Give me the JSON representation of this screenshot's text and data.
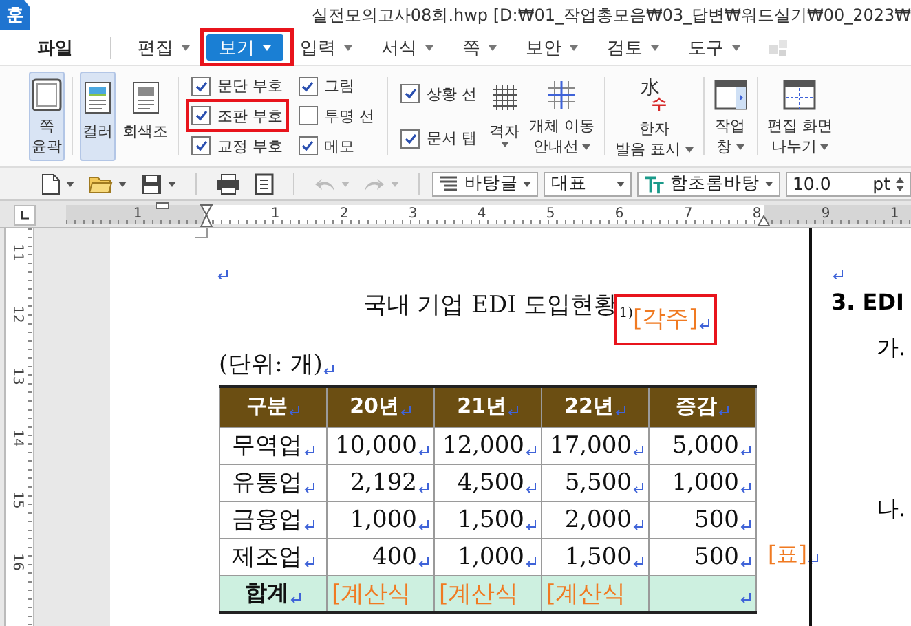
{
  "title_bar": {
    "logo": "훈",
    "title": "실전모의고사08회.hwp [D:₩01_작업총모음₩03_답변₩워드실기₩00_2023₩"
  },
  "menu": [
    {
      "label": "파일",
      "menu": false,
      "selected": false,
      "highlighted": false
    },
    {
      "label": "편집",
      "menu": true,
      "selected": false,
      "highlighted": false
    },
    {
      "label": "보기",
      "menu": true,
      "selected": true,
      "highlighted": true
    },
    {
      "label": "입력",
      "menu": true,
      "selected": false,
      "highlighted": false
    },
    {
      "label": "서식",
      "menu": true,
      "selected": false,
      "highlighted": false
    },
    {
      "label": "쪽",
      "menu": true,
      "selected": false,
      "highlighted": false
    },
    {
      "label": "보안",
      "menu": true,
      "selected": false,
      "highlighted": false
    },
    {
      "label": "검토",
      "menu": true,
      "selected": false,
      "highlighted": false
    },
    {
      "label": "도구",
      "menu": true,
      "selected": false,
      "highlighted": false
    }
  ],
  "ribbon": {
    "groups": [
      [
        {
          "kind": "outline",
          "lines": [
            "쪽",
            "윤곽"
          ],
          "selected": true,
          "menu": false
        }
      ],
      [
        {
          "kind": "color",
          "lines": [
            "컬러"
          ],
          "selected": true,
          "menu": false
        },
        {
          "kind": "gray",
          "lines": [
            "회색조"
          ],
          "selected": false,
          "menu": false
        }
      ],
      [
        {
          "kind": "checks",
          "items": [
            {
              "label": "문단 부호",
              "checked": true,
              "highlighted": false
            },
            {
              "label": "조판 부호",
              "checked": true,
              "highlighted": true
            },
            {
              "label": "교정 부호",
              "checked": true,
              "highlighted": false
            }
          ]
        },
        {
          "kind": "checks",
          "items": [
            {
              "label": "그림",
              "checked": true,
              "highlighted": false
            },
            {
              "label": "투명 선",
              "checked": false,
              "highlighted": false
            },
            {
              "label": "메모",
              "checked": true,
              "highlighted": false
            }
          ]
        }
      ],
      [
        {
          "kind": "checks",
          "items": [
            {
              "label": "상황 선",
              "checked": true,
              "highlighted": false
            },
            {
              "label": "문서 탭",
              "checked": true,
              "highlighted": false
            }
          ]
        },
        {
          "kind": "grid",
          "lines": [
            "격자"
          ],
          "selected": false,
          "menu": true
        },
        {
          "kind": "guides",
          "lines": [
            "개체 이동",
            "안내선"
          ],
          "selected": false,
          "menu": true
        }
      ],
      [
        {
          "kind": "hanja",
          "lines": [
            "한자",
            "발음 표시"
          ],
          "selected": false,
          "menu": true,
          "icon_chars": [
            "水",
            "수"
          ]
        }
      ],
      [
        {
          "kind": "pane",
          "lines": [
            "작업",
            "창"
          ],
          "selected": false,
          "menu": true
        }
      ],
      [
        {
          "kind": "split",
          "lines": [
            "편집 화면",
            "나누기"
          ],
          "selected": false,
          "menu": true
        }
      ]
    ]
  },
  "toolbar": {
    "groups": [
      [
        {
          "kind": "new",
          "menu": true,
          "disabled": false
        },
        {
          "kind": "open",
          "menu": true,
          "disabled": false
        },
        {
          "kind": "save",
          "menu": true,
          "disabled": false
        }
      ],
      [
        {
          "kind": "print",
          "menu": false,
          "disabled": false
        },
        {
          "kind": "preview",
          "menu": false,
          "disabled": false
        }
      ],
      [
        {
          "kind": "undo",
          "menu": true,
          "disabled": true
        },
        {
          "kind": "redo",
          "menu": true,
          "disabled": true
        }
      ]
    ],
    "combos": [
      {
        "kind": "style",
        "value": "바탕글"
      },
      {
        "kind": "plain",
        "value": "대표"
      },
      {
        "kind": "font",
        "value": "함초롬바탕"
      },
      {
        "kind": "size",
        "value": "10.0",
        "unit": "pt"
      }
    ]
  },
  "ruler": {
    "numbers": [
      "1",
      "1",
      "2",
      "3",
      "4",
      "5",
      "6",
      "7",
      "8",
      "9",
      "1"
    ],
    "vertical_numbers": [
      "11",
      "12",
      "13",
      "14",
      "15",
      "16"
    ]
  },
  "document": {
    "paragraph_marks": true,
    "left": {
      "title": "국내 기업 EDI 도입현황",
      "footnote_mark": "1)",
      "footnote_field": "[각주]",
      "footnote_highlighted": true,
      "unit": "(단위: 개)",
      "table": {
        "columns": [
          "구분",
          "20년",
          "21년",
          "22년",
          "증감"
        ],
        "rows": [
          [
            "무역업",
            "10,000",
            "12,000",
            "17,000",
            "5,000"
          ],
          [
            "유통업",
            "2,192",
            "4,500",
            "5,500",
            "1,000"
          ],
          [
            "금융업",
            "1,000",
            "1,500",
            "2,000",
            "500"
          ],
          [
            "제조업",
            "400",
            "1,000",
            "1,500",
            "500"
          ]
        ],
        "total": {
          "label": "합계",
          "cells": [
            "[계산식",
            "[계산식",
            "[계산식"
          ]
        }
      },
      "table_field": "[표]"
    },
    "right": {
      "heading": "3. EDI",
      "items": [
        "가.",
        "나."
      ]
    }
  }
}
